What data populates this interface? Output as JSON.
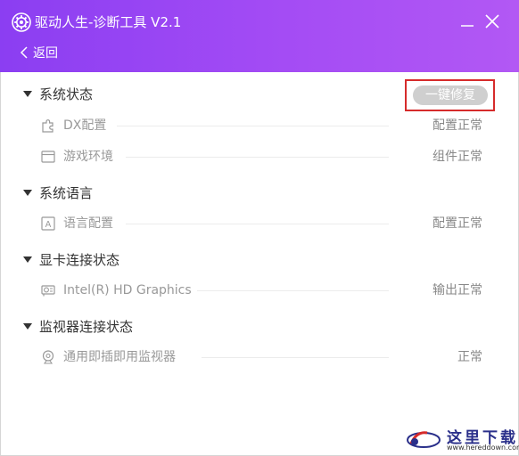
{
  "window": {
    "title": "驱动人生-诊断工具 V2.1",
    "back_label": "返回",
    "accent_color": "#9b47f3"
  },
  "fix_button": {
    "label": "一键修复"
  },
  "sections": [
    {
      "title": "系统状态",
      "items": [
        {
          "icon": "puzzle-icon",
          "label": "DX配置",
          "status": "配置正常"
        },
        {
          "icon": "window-icon",
          "label": "游戏环境",
          "status": "组件正常"
        }
      ]
    },
    {
      "title": "系统语言",
      "items": [
        {
          "icon": "letter-a-icon",
          "label": "语言配置",
          "status": "配置正常"
        }
      ]
    },
    {
      "title": "显卡连接状态",
      "items": [
        {
          "icon": "graphics-card-icon",
          "label": "Intel(R) HD Graphics",
          "status": "输出正常"
        }
      ]
    },
    {
      "title": "监视器连接状态",
      "items": [
        {
          "icon": "webcam-icon",
          "label": "通用即插即用监视器",
          "status": "正常"
        }
      ]
    }
  ],
  "watermark": {
    "text": "这里下载",
    "url": "www.hereddown.com"
  }
}
